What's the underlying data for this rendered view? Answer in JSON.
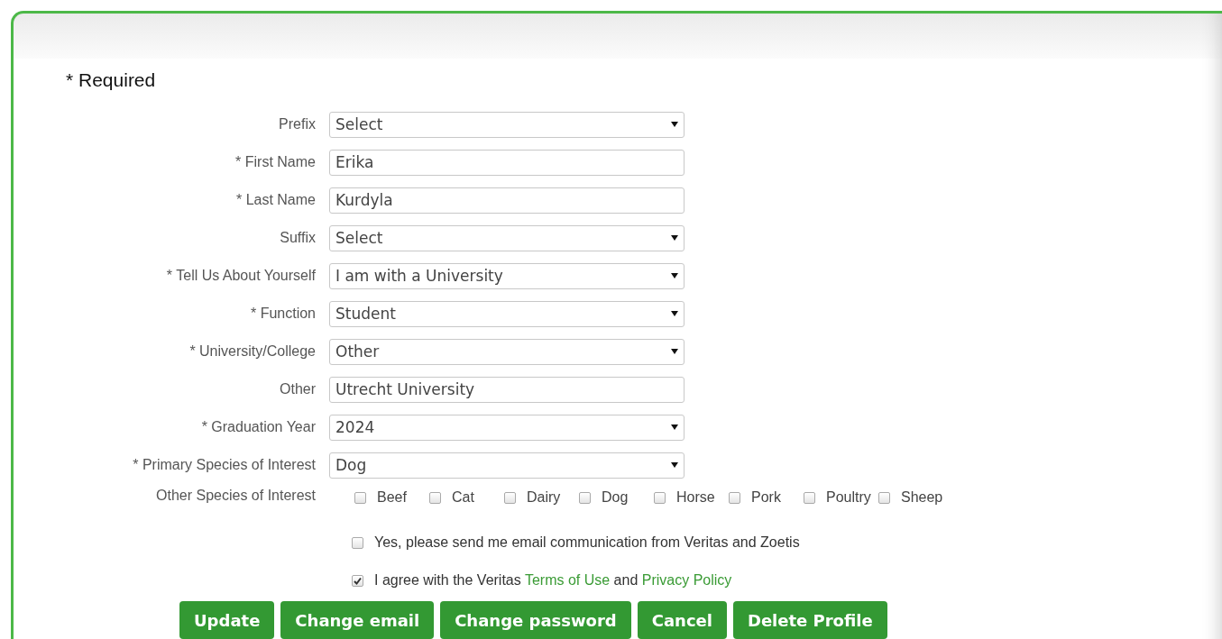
{
  "required_note": "* Required",
  "fields": [
    {
      "label": "Prefix",
      "kind": "select",
      "value": "Select"
    },
    {
      "label": "* First Name",
      "kind": "text",
      "value": "Erika"
    },
    {
      "label": "* Last Name",
      "kind": "text",
      "value": "Kurdyla"
    },
    {
      "label": "Suffix",
      "kind": "select",
      "value": "Select"
    },
    {
      "label": "* Tell Us About Yourself",
      "kind": "select",
      "value": "I am with a University"
    },
    {
      "label": "* Function",
      "kind": "select",
      "value": "Student"
    },
    {
      "label": "* University/College",
      "kind": "select",
      "value": "Other"
    },
    {
      "label": "Other",
      "kind": "text",
      "value": "Utrecht University"
    },
    {
      "label": "* Graduation Year",
      "kind": "select",
      "value": "2024"
    },
    {
      "label": "* Primary Species of Interest",
      "kind": "select",
      "value": "Dog"
    }
  ],
  "other_species": {
    "label": "Other Species of Interest",
    "options": [
      {
        "label": "Beef",
        "checked": false
      },
      {
        "label": "Cat",
        "checked": false
      },
      {
        "label": "Dairy",
        "checked": false
      },
      {
        "label": "Dog",
        "checked": false
      },
      {
        "label": "Horse",
        "checked": false
      },
      {
        "label": "Pork",
        "checked": false
      },
      {
        "label": "Poultry",
        "checked": false
      },
      {
        "label": "Sheep",
        "checked": false
      }
    ]
  },
  "email_opt_in": {
    "text": "Yes, please send me email communication from Veritas and Zoetis",
    "checked": false
  },
  "agreement": {
    "checked": true,
    "before": "I agree with the Veritas ",
    "terms_link": "Terms of Use",
    "middle": " and ",
    "privacy_link": "Privacy Policy"
  },
  "buttons": [
    "Update",
    "Change email",
    "Change password",
    "Cancel",
    "Delete Profile"
  ]
}
